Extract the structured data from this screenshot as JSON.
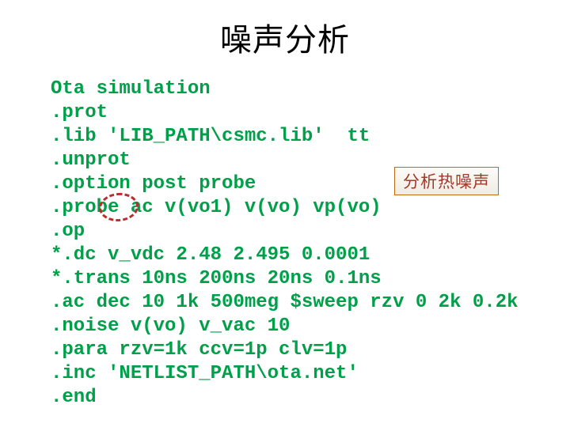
{
  "title": "噪声分析",
  "callout": "分析热噪声",
  "code": {
    "l1": "Ota simulation",
    "l2": ".prot",
    "l3": ".lib 'LIB_PATH\\csmc.lib'  tt",
    "l4": ".unprot",
    "l5": ".option post probe",
    "l6": ".probe ac v(vo1) v(vo) vp(vo)",
    "l7": ".op",
    "l8": "*.dc v_vdc 2.48 2.495 0.0001",
    "l9": "*.trans 10ns 200ns 20ns 0.1ns",
    "l10": ".ac dec 10 1k 500meg $sweep rzv 0 2k 0.2k",
    "l11": ".noise v(vo) v_vac 10",
    "l12": ".para rzv=1k ccv=1p clv=1p",
    "l13": ".inc 'NETLIST_PATH\\ota.net'",
    "l14": ".end"
  }
}
